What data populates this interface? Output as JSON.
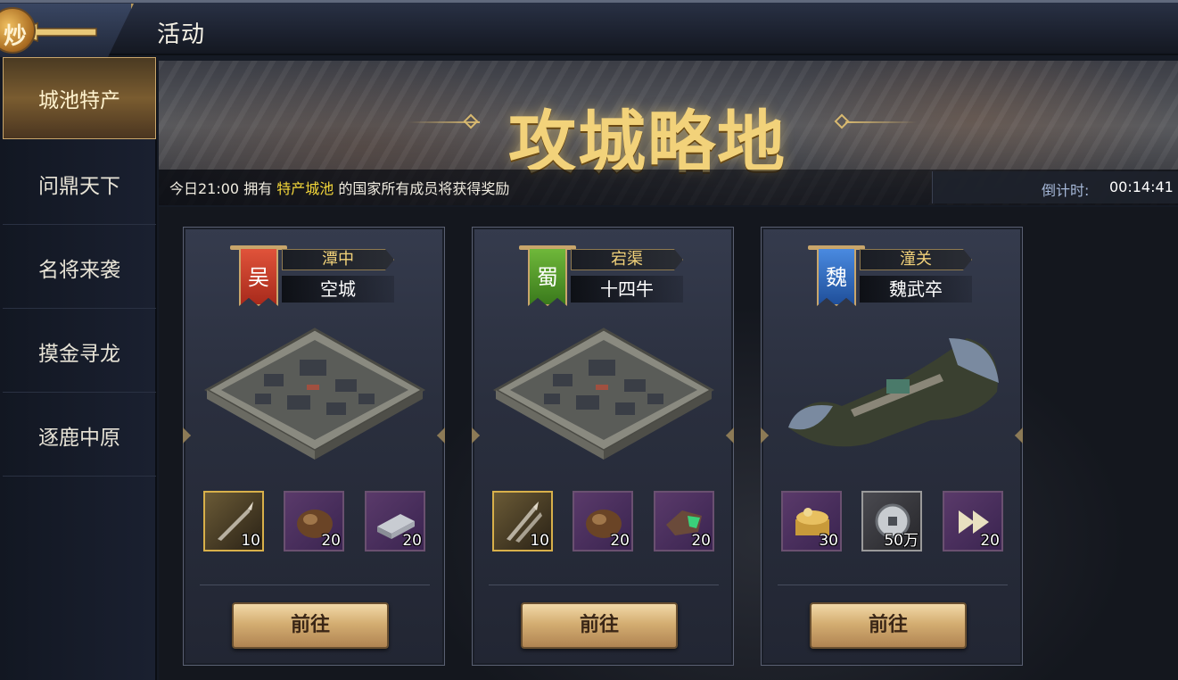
{
  "header": {
    "title": "活动",
    "back_icon": "back-arrow-icon"
  },
  "sidebar": {
    "badge_glyph": "炒",
    "items": [
      {
        "label": "城池特产",
        "active": true
      },
      {
        "label": "问鼎天下",
        "active": false
      },
      {
        "label": "名将来袭",
        "active": false
      },
      {
        "label": "摸金寻龙",
        "active": false
      },
      {
        "label": "逐鹿中原",
        "active": false
      }
    ]
  },
  "banner": {
    "title": "攻城略地",
    "info_prefix": "今日21:00 拥有 ",
    "info_highlight": "特产城池",
    "info_suffix": " 的国家所有成员将获得奖励",
    "timer_label": "倒计时:",
    "timer_value": "00:14:41"
  },
  "cards": [
    {
      "faction": "吴",
      "place": "潭中",
      "garrison": "空城",
      "items": [
        {
          "icon": "spear-icon",
          "qty": "10"
        },
        {
          "icon": "wood-log-icon",
          "qty": "20"
        },
        {
          "icon": "iron-ingot-icon",
          "qty": "20"
        }
      ],
      "button": "前往"
    },
    {
      "faction": "蜀",
      "place": "宕渠",
      "garrison": "十四牛",
      "items": [
        {
          "icon": "spears-icon",
          "qty": "10"
        },
        {
          "icon": "wood-log-icon",
          "qty": "20"
        },
        {
          "icon": "jade-ore-icon",
          "qty": "20"
        }
      ],
      "button": "前往"
    },
    {
      "faction": "魏",
      "place": "潼关",
      "garrison": "魏武卒",
      "items": [
        {
          "icon": "treasure-chest-icon",
          "qty": "30"
        },
        {
          "icon": "coin-icon",
          "qty": "50万"
        },
        {
          "icon": "fast-forward-icon",
          "qty": "20"
        }
      ],
      "button": "前往"
    }
  ],
  "colors": {
    "accent_gold": "#f2d27a",
    "highlight_yellow": "#f5d83a",
    "timer_label": "#a6b8d8"
  }
}
